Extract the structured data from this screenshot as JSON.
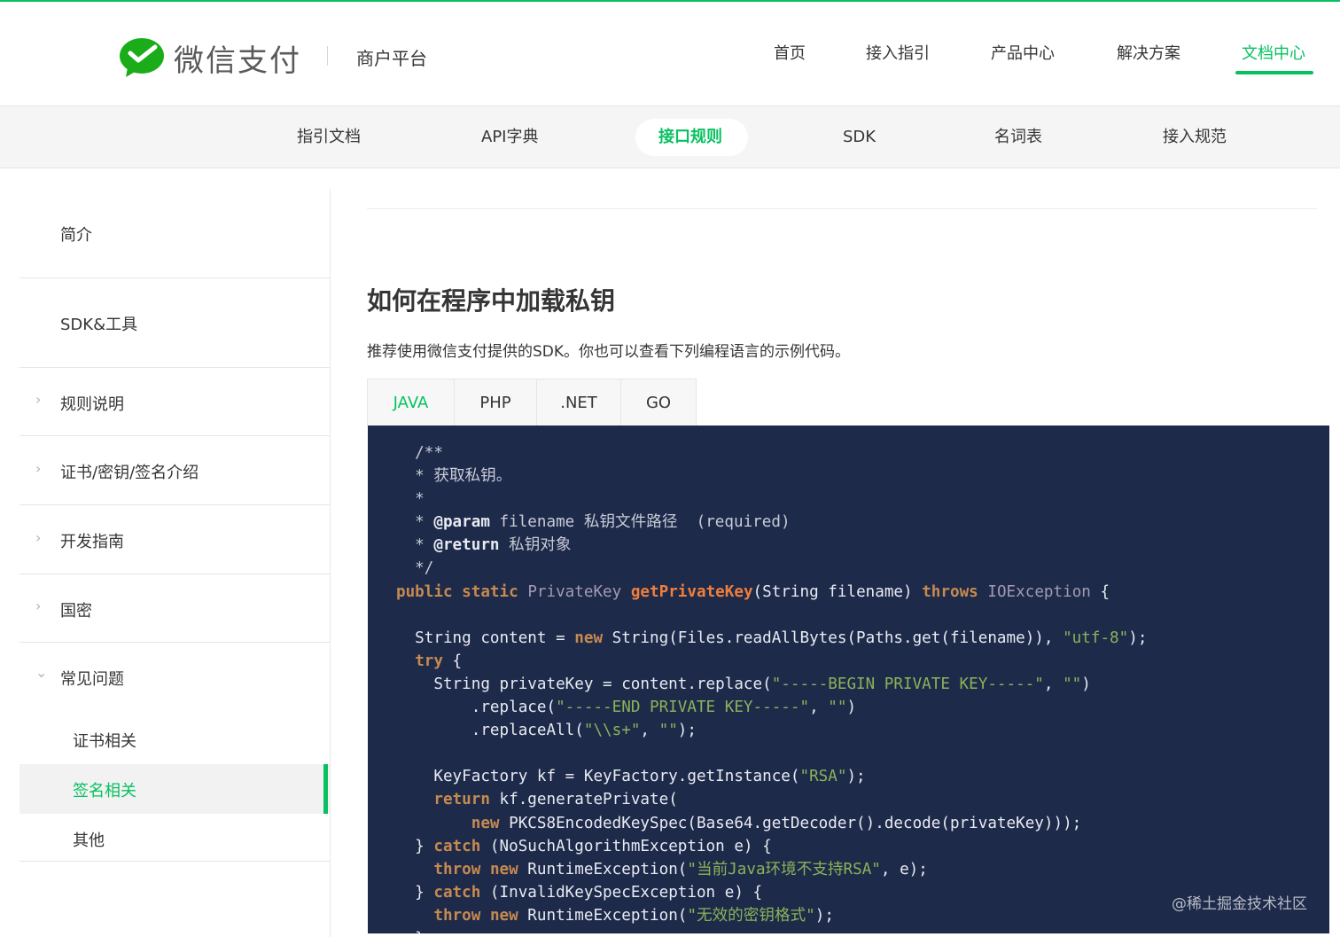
{
  "header": {
    "brand": "微信支付",
    "subbrand": "商户平台",
    "nav": [
      "首页",
      "接入指引",
      "产品中心",
      "解决方案",
      "文档中心"
    ],
    "active_nav": "文档中心"
  },
  "subnav": {
    "items": [
      "指引文档",
      "API字典",
      "接口规则",
      "SDK",
      "名词表",
      "接入规范"
    ],
    "active": "接口规则"
  },
  "sidebar": {
    "items": [
      {
        "label": "简介"
      },
      {
        "label": "SDK&工具"
      },
      {
        "label": "规则说明",
        "chevron": "›"
      },
      {
        "label": "证书/密钥/签名介绍",
        "chevron": "›"
      },
      {
        "label": "开发指南",
        "chevron": "›"
      },
      {
        "label": "国密",
        "chevron": "›"
      },
      {
        "label": "常见问题",
        "chevron": "⌄"
      }
    ],
    "sub_items": [
      {
        "label": "证书相关"
      },
      {
        "label": "签名相关",
        "active": true
      },
      {
        "label": "其他"
      }
    ]
  },
  "main": {
    "title": "如何在程序中加载私钥",
    "intro": "推荐使用微信支付提供的SDK。你也可以查看下列编程语言的示例代码。",
    "tabs": [
      "JAVA",
      "PHP",
      ".NET",
      "GO"
    ],
    "active_tab": "JAVA",
    "code_lines": [
      "  /**",
      "  * 获取私钥。",
      "  *",
      "  * @param filename 私钥文件路径  (required)",
      "  * @return 私钥对象",
      "  */",
      "public static PrivateKey getPrivateKey(String filename) throws IOException {",
      "",
      "  String content = new String(Files.readAllBytes(Paths.get(filename)), \"utf-8\");",
      "  try {",
      "    String privateKey = content.replace(\"-----BEGIN PRIVATE KEY-----\", \"\")",
      "        .replace(\"-----END PRIVATE KEY-----\", \"\")",
      "        .replaceAll(\"\\\\s+\", \"\");",
      "",
      "    KeyFactory kf = KeyFactory.getInstance(\"RSA\");",
      "    return kf.generatePrivate(",
      "        new PKCS8EncodedKeySpec(Base64.getDecoder().decode(privateKey)));",
      "  } catch (NoSuchAlgorithmException e) {",
      "    throw new RuntimeException(\"当前Java环境不支持RSA\", e);",
      "  } catch (InvalidKeySpecException e) {",
      "    throw new RuntimeException(\"无效的密钥格式\");",
      "  }"
    ]
  },
  "watermark": "@稀土掘金技术社区",
  "colors": {
    "accent": "#07c160",
    "code_bg": "#1e2a4a",
    "keyword": "#c68a50",
    "string": "#8ab359",
    "method": "#ef7f3e"
  },
  "icons": {
    "logo": "wechat-pay-logo-icon",
    "chevron_right": "chevron-right-icon",
    "chevron_down": "chevron-down-icon"
  }
}
